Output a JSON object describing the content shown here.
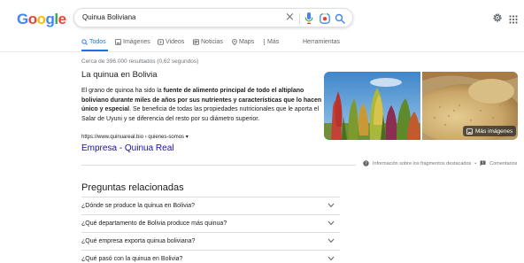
{
  "app": {
    "logo_letters": [
      "G",
      "o",
      "o",
      "g",
      "l",
      "e"
    ],
    "logo_colors": [
      "#4285f4",
      "#ea4335",
      "#fbbc05",
      "#4285f4",
      "#34a853",
      "#ea4335"
    ]
  },
  "search": {
    "query": "Quinua Boliviana",
    "clear_glyph": "×"
  },
  "header_icons": {
    "settings": "gear-icon",
    "apps": "apps-grid-icon"
  },
  "tabs": [
    {
      "label": "Todos",
      "icon": "search-icon",
      "active": true
    },
    {
      "label": "Imágenes",
      "icon": "image-icon",
      "active": false
    },
    {
      "label": "Videos",
      "icon": "video-icon",
      "active": false
    },
    {
      "label": "Noticias",
      "icon": "news-icon",
      "active": false
    },
    {
      "label": "Maps",
      "icon": "map-pin-icon",
      "active": false
    },
    {
      "label": "Más",
      "icon": "more-vertical-icon",
      "active": false
    },
    {
      "label": "Herramientas",
      "icon": "",
      "active": false
    }
  ],
  "results": {
    "stats": "Cerca de 396.000 resultados (0,62 segundos)"
  },
  "featured_snippet": {
    "title": "La quinua en Bolivia",
    "text_1": "El grano de quinoa ha sido la ",
    "bold_1": "fuente de alimento principal de todo el altiplano boliviano durante miles de años por sus nutrientes y características que lo hacen único y especial",
    "text_2": ". Se beneficia de todas las propiedades nutricionales que le aporta el Salar de Uyuni y se diferencia del resto por su diámetro superior.",
    "more_images": "Más imágenes",
    "source_url": "https://www.quinuareal.bio › quienes-somos",
    "source_caret": "▾",
    "source_title": "Empresa - Quinua Real",
    "feedback_info": "Información sobre los fragmentos destacados",
    "feedback_sep": "•",
    "feedback_comments": "Comentarios"
  },
  "related_questions": {
    "title": "Preguntas relacionadas",
    "items": [
      "¿Dónde se produce la quinua en Bolivia?",
      "¿Qué departamento de Bolivia produce más quinua?",
      "¿Qué empresa exporta quinua boliviana?",
      "¿Qué pasó con la quinua en Bolivia?"
    ]
  },
  "colors": {
    "accent": "#1a73e8",
    "link": "#1a0dab",
    "text": "#202124",
    "muted": "#70757a"
  }
}
